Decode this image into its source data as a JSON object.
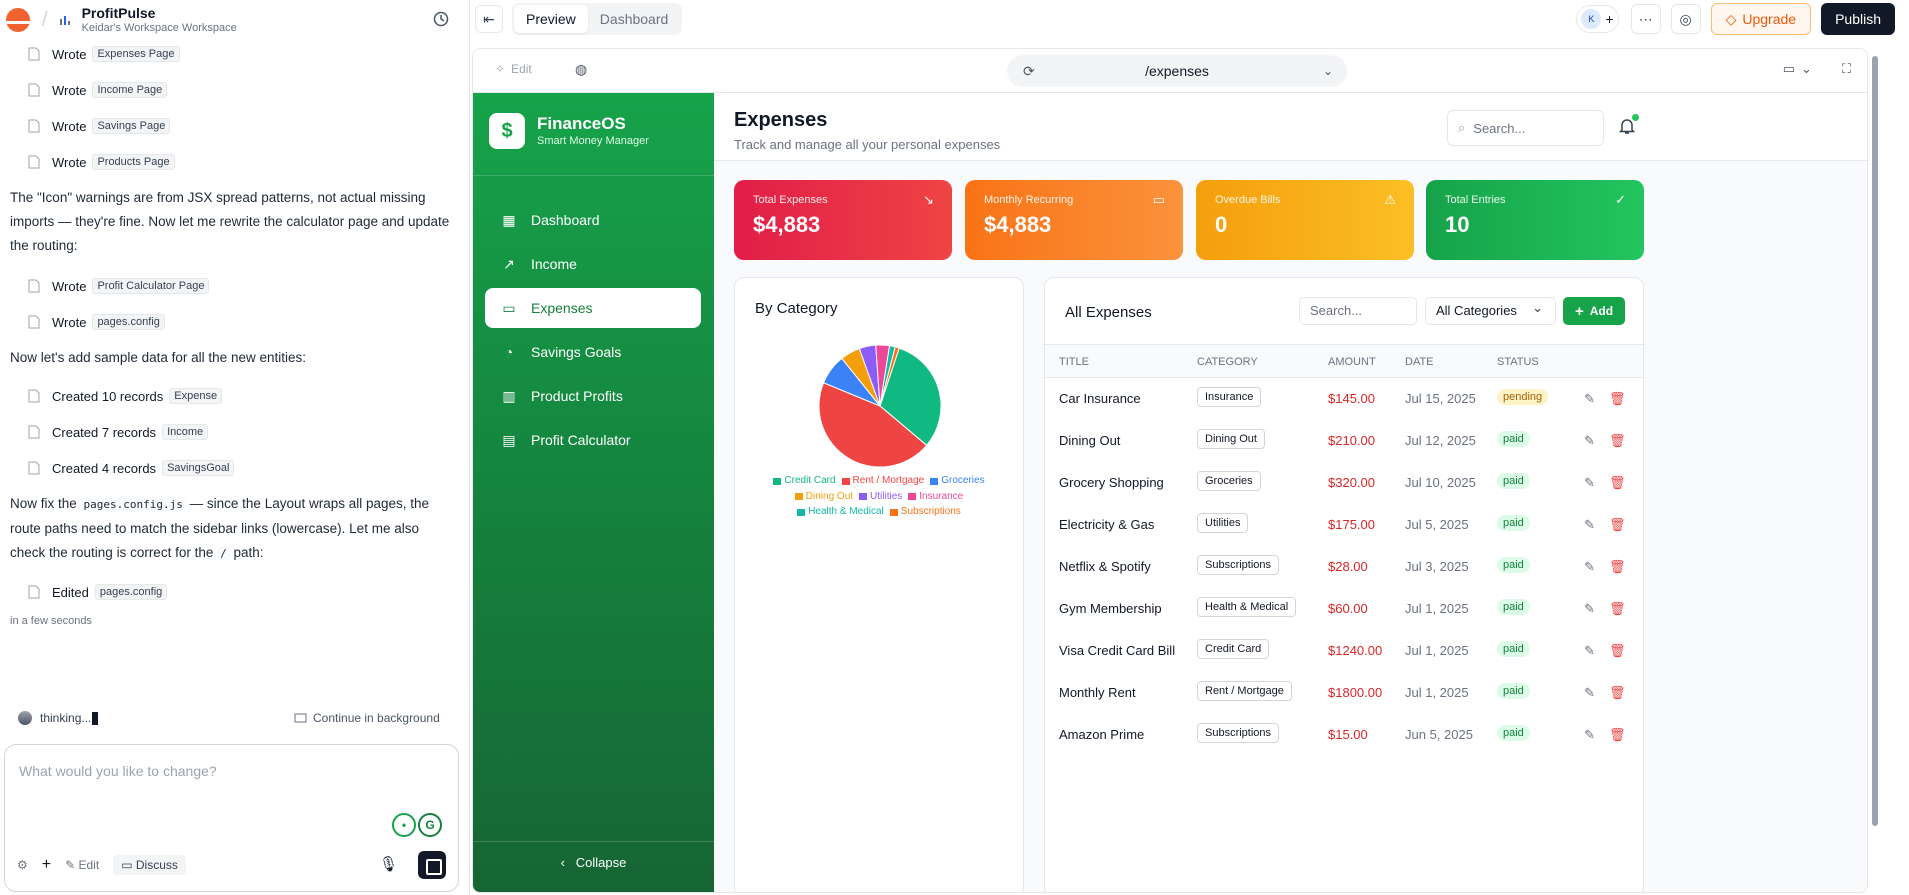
{
  "project": {
    "name": "ProfitPulse",
    "workspace": "Keidar's Workspace Workspace"
  },
  "chat": {
    "log_top": [
      {
        "verb": "Wrote",
        "chip": "Expenses Page"
      },
      {
        "verb": "Wrote",
        "chip": "Income Page"
      },
      {
        "verb": "Wrote",
        "chip": "Savings Page"
      },
      {
        "verb": "Wrote",
        "chip": "Products Page"
      }
    ],
    "para1": "The \"Icon\" warnings are from JSX spread patterns, not actual missing imports — they're fine. Now let me rewrite the calculator page and update the routing:",
    "log_mid": [
      {
        "verb": "Wrote",
        "chip": "Profit Calculator Page"
      },
      {
        "verb": "Wrote",
        "chip": "pages.config"
      }
    ],
    "para2": "Now let's add sample data for all the new entities:",
    "log_data": [
      {
        "verb": "Created 10 records",
        "chip": "Expense"
      },
      {
        "verb": "Created 7 records",
        "chip": "Income"
      },
      {
        "verb": "Created 4 records",
        "chip": "SavingsGoal"
      }
    ],
    "para3a": "Now fix the",
    "para3_code": "pages.config.js",
    "para3b": "— since the Layout wraps all pages, the route paths need to match the sidebar links (lowercase). Let me also check the routing is correct for the",
    "para3_code2": "/",
    "para3c": "path:",
    "log_end": {
      "verb": "Edited",
      "chip": "pages.config"
    },
    "timestamp": "in a few seconds",
    "thinking": "thinking...",
    "continue_bg": "Continue in background",
    "composer_placeholder": "What would you like to change?",
    "bar": {
      "edit": "Edit",
      "discuss": "Discuss"
    }
  },
  "topbar": {
    "tabs": [
      "Preview",
      "Dashboard"
    ],
    "avatar_initial": "K",
    "upgrade": "Upgrade",
    "publish": "Publish"
  },
  "preview": {
    "edit": "Edit",
    "url": "/expenses"
  },
  "app": {
    "brand": "FinanceOS",
    "tagline": "Smart Money Manager",
    "nav": [
      "Dashboard",
      "Income",
      "Expenses",
      "Savings Goals",
      "Product Profits",
      "Profit Calculator"
    ],
    "active_nav": "Expenses",
    "collapse": "Collapse",
    "page_title": "Expenses",
    "page_sub": "Track and manage all your personal expenses",
    "search_placeholder": "Search...",
    "stats": [
      {
        "label": "Total Expenses",
        "value": "$4,883",
        "icon": "trending-down-icon"
      },
      {
        "label": "Monthly Recurring",
        "value": "$4,883",
        "icon": "credit-card-icon"
      },
      {
        "label": "Overdue Bills",
        "value": "0",
        "icon": "alert-triangle-icon"
      },
      {
        "label": "Total Entries",
        "value": "10",
        "icon": "check-circle-icon"
      }
    ],
    "by_category_title": "By Category",
    "all_expenses_title": "All Expenses",
    "filter_search": "Search...",
    "filter_category": "All Categories",
    "add": "Add",
    "columns": [
      "TITLE",
      "CATEGORY",
      "AMOUNT",
      "DATE",
      "STATUS"
    ],
    "rows": [
      {
        "title": "Car Insurance",
        "category": "Insurance",
        "amount": "$145.00",
        "date": "Jul 15, 2025",
        "status": "pending"
      },
      {
        "title": "Dining Out",
        "category": "Dining Out",
        "amount": "$210.00",
        "date": "Jul 12, 2025",
        "status": "paid"
      },
      {
        "title": "Grocery Shopping",
        "category": "Groceries",
        "amount": "$320.00",
        "date": "Jul 10, 2025",
        "status": "paid"
      },
      {
        "title": "Electricity & Gas",
        "category": "Utilities",
        "amount": "$175.00",
        "date": "Jul 5, 2025",
        "status": "paid"
      },
      {
        "title": "Netflix & Spotify",
        "category": "Subscriptions",
        "amount": "$28.00",
        "date": "Jul 3, 2025",
        "status": "paid"
      },
      {
        "title": "Gym Membership",
        "category": "Health & Medical",
        "amount": "$60.00",
        "date": "Jul 1, 2025",
        "status": "paid"
      },
      {
        "title": "Visa Credit Card Bill",
        "category": "Credit Card",
        "amount": "$1240.00",
        "date": "Jul 1, 2025",
        "status": "paid"
      },
      {
        "title": "Monthly Rent",
        "category": "Rent / Mortgage",
        "amount": "$1800.00",
        "date": "Jul 1, 2025",
        "status": "paid"
      },
      {
        "title": "Amazon Prime",
        "category": "Subscriptions",
        "amount": "$15.00",
        "date": "Jun 5, 2025",
        "status": "paid"
      }
    ]
  },
  "chart_data": {
    "type": "pie",
    "title": "By Category",
    "series": [
      {
        "name": "Credit Card",
        "value": 1240,
        "color": "#10b981"
      },
      {
        "name": "Rent / Mortgage",
        "value": 1800,
        "color": "#ef4444"
      },
      {
        "name": "Groceries",
        "value": 320,
        "color": "#3b82f6"
      },
      {
        "name": "Dining Out",
        "value": 210,
        "color": "#f59e0b"
      },
      {
        "name": "Utilities",
        "value": 175,
        "color": "#8b5cf6"
      },
      {
        "name": "Insurance",
        "value": 145,
        "color": "#ec4899"
      },
      {
        "name": "Health & Medical",
        "value": 60,
        "color": "#14b8a6"
      },
      {
        "name": "Subscriptions",
        "value": 43,
        "color": "#f97316"
      }
    ],
    "legend_position": "bottom"
  }
}
